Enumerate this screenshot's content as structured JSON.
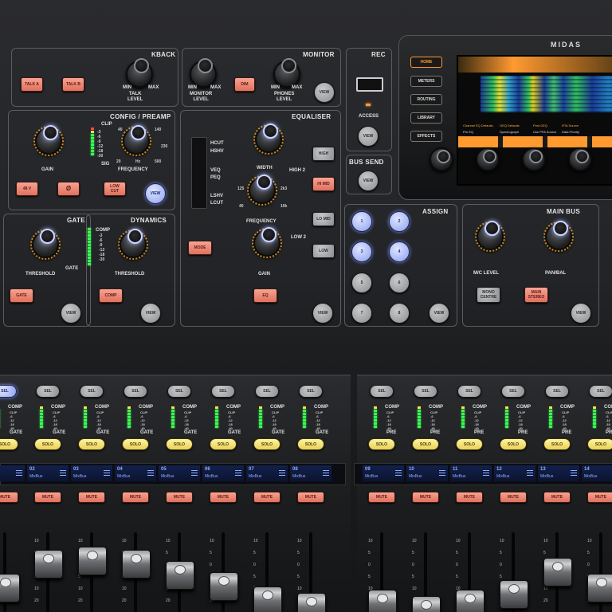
{
  "brand": {
    "logo": "MIDAS"
  },
  "talkback": {
    "title": "KBACK",
    "talk_a": "TALK A",
    "talk_b": "TALK B",
    "level": "TALK\nLEVEL",
    "min": "MIN",
    "max": "MAX"
  },
  "monitor": {
    "title": "MONITOR",
    "dim": "DIM",
    "monitor_level": "MONITOR\nLEVEL",
    "phones_level": "PHONES\nLEVEL",
    "view": "VIEW",
    "min": "MIN",
    "max": "MAX"
  },
  "rec": {
    "title": "REC",
    "access": "ACCESS",
    "view": "VIEW"
  },
  "screen_buttons": [
    "HOME",
    "METERS",
    "ROUTING",
    "LIBRARY",
    "EFFECTS"
  ],
  "lcd": {
    "line1": "Channel EQ Defaults",
    "line2": "GEQ Defaults",
    "line3": "Post GEQ",
    "line4": "RTA Source",
    "sub1": "Pre EQ",
    "sub2": "Spectrograph",
    "sub3": "Use PFA Source",
    "sub4": "Data Priority"
  },
  "config": {
    "title": "CONFIG / PREAMP",
    "gain": "GAIN",
    "frequency": "FREQUENCY",
    "clip": "CLIP",
    "sig": "SIG",
    "scale": [
      "-3",
      "-6",
      "-9",
      "-12",
      "-18",
      "-30"
    ],
    "freq_marks": [
      "40",
      "140",
      "230",
      "20",
      "500"
    ],
    "hz": "Hz",
    "btn1": "48 V",
    "btn2": "Ø",
    "btn3": "LOW\nCUT",
    "view": "VIEW"
  },
  "equaliser": {
    "title": "EQUALISER",
    "width": "WIDTH",
    "frequency": "FREQUENCY",
    "gain": "GAIN",
    "modes": [
      "HCUT",
      "HSHV",
      "VEQ",
      "PEQ",
      "LSHV",
      "LCUT"
    ],
    "high2": "HIGH 2",
    "low2": "LOW 2",
    "high": "HIGH",
    "hi_mid": "HI MID",
    "lo_mid": "LO MID",
    "low": "LOW",
    "mode": "MODE",
    "eq": "EQ",
    "view": "VIEW",
    "marks": [
      "125",
      "2k3",
      "40",
      "10k"
    ]
  },
  "bus_send": {
    "title": "BUS SEND",
    "view": "VIEW"
  },
  "gate": {
    "title": "GATE",
    "threshold": "THRESHOLD",
    "gate_label": "GATE",
    "btn": "GATE",
    "view": "VIEW"
  },
  "dynamics": {
    "title": "DYNAMICS",
    "threshold": "THRESHOLD",
    "comp": "COMP",
    "scale": [
      "-3",
      "-6",
      "-9",
      "-12",
      "-18",
      "-30"
    ],
    "btn": "COMP",
    "view": "VIEW"
  },
  "assign": {
    "title": "ASSIGN",
    "buttons": [
      "1",
      "2",
      "3",
      "4",
      "5",
      "6",
      "7",
      "8"
    ],
    "view": "VIEW"
  },
  "main_bus": {
    "title": "MAIN BUS",
    "mc_level": "M/C LEVEL",
    "pan_bal": "PAN/BAL",
    "mono_centre": "MONO\nCENTRE",
    "main_stereo": "MAIN\nSTEREO",
    "view": "VIEW"
  },
  "strip_labels": {
    "sel": "SEL",
    "solo": "SOLO",
    "mute": "MUTE",
    "comp": "COMP",
    "gate": "GATE",
    "pre": "PRE",
    "scale": [
      "CLIP",
      "-6",
      "-12",
      "-18",
      "-40"
    ],
    "fader_ticks": [
      "10",
      "5",
      "0",
      "5",
      "10",
      "20"
    ]
  },
  "scribble_left": [
    {
      "num": "",
      "name": ""
    },
    {
      "num": "02",
      "name": "MixBus"
    },
    {
      "num": "03",
      "name": "MixBus"
    },
    {
      "num": "04",
      "name": "MixBus"
    },
    {
      "num": "05",
      "name": "MixBus"
    },
    {
      "num": "06",
      "name": "MixBus"
    },
    {
      "num": "07",
      "name": "MixBus"
    },
    {
      "num": "08",
      "name": "MixBus"
    }
  ],
  "scribble_right": [
    {
      "num": "09",
      "name": "MixBus"
    },
    {
      "num": "10",
      "name": "MixBus"
    },
    {
      "num": "11",
      "name": "MixBus"
    },
    {
      "num": "12",
      "name": "MixBus"
    },
    {
      "num": "13",
      "name": "MixBus"
    },
    {
      "num": "14",
      "name": "MixBus"
    }
  ]
}
